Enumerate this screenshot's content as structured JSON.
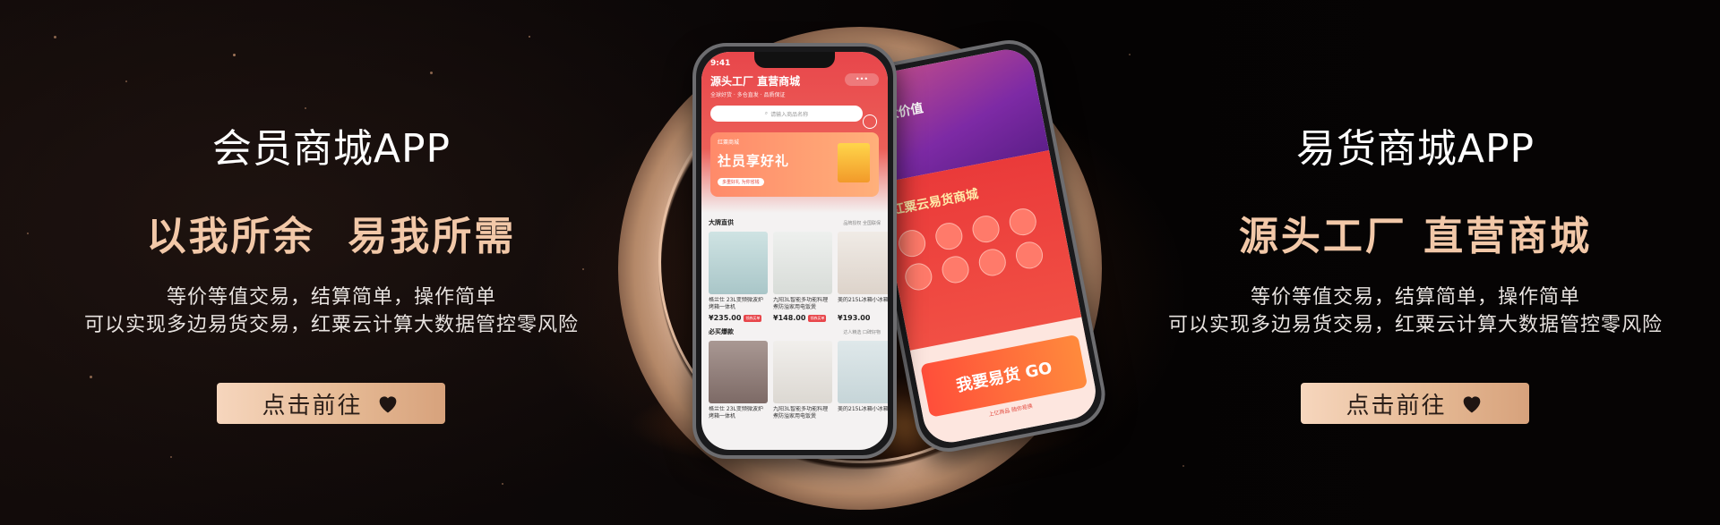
{
  "left": {
    "title": "会员商城APP",
    "slogan": "以我所余  易我所需",
    "desc_line1": "等价等值交易，结算简单，操作简单",
    "desc_line2": "可以实现多边易货交易，红粟云计算大数据管控零风险",
    "cta_label": "点击前往",
    "cta_icon": "heart-icon"
  },
  "right": {
    "title": "易货商城APP",
    "slogan": "源头工厂 直营商城",
    "desc_line1": "等价等值交易，结算简单，操作简单",
    "desc_line2": "可以实现多边易货交易，红粟云计算大数据管控零风险",
    "cta_label": "点击前往",
    "cta_icon": "heart-icon"
  },
  "phone_front": {
    "time": "9:41",
    "title": "源头工厂 直营商城",
    "subtitle": "全球好货 · 多仓直发 · 品质保证",
    "search_placeholder": "请输入商品名称",
    "banner_label": "红粟商城",
    "banner_headline": "社员享好礼",
    "banner_pill": "多重好礼 为你省钱",
    "section1": {
      "title": "大牌直供",
      "tags": "品牌授权  全国联保",
      "items": [
        {
          "name": "格兰仕 23L变频微波炉烤箱一体机",
          "price": "¥235.00",
          "tag": "领券买单"
        },
        {
          "name": "九阳3L智能多功能料理煮防溢家用电饭煲",
          "price": "¥148.00",
          "tag": "领券买单"
        },
        {
          "name": "美的215L冰箱小冰箱",
          "price": "¥193.00",
          "tag": ""
        }
      ]
    },
    "section2": {
      "title": "必买爆款",
      "tags": "达人精选  口碑好物",
      "items": [
        {
          "name": "格兰仕 23L变频微波炉烤箱一体机"
        },
        {
          "name": "九阳3L智能多功能料理煮防溢家用电饭煲"
        },
        {
          "name": "美的215L冰箱小冰箱"
        }
      ]
    }
  },
  "phone_back": {
    "top_text": "五大价值",
    "mid_logo": "红粟云易货商城",
    "bottom_banner": "我要易货 GO",
    "bottom_sub": "上亿商品 随你易换"
  },
  "colors": {
    "accent_gold": "#f2c8a8",
    "cta_gradient_start": "#f6d6bd",
    "cta_gradient_end": "#d7a27c",
    "app_red": "#e8464b"
  }
}
